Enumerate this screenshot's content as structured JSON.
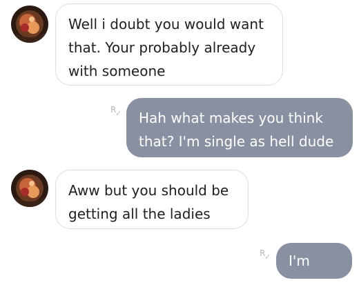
{
  "conversation": {
    "messages": [
      {
        "direction": "incoming",
        "text": "Well i doubt you would want\nthat. Your probably already\nwith someone"
      },
      {
        "direction": "outgoing",
        "text": "Hah what makes you think\nthat? I'm single as hell dude",
        "receipt_icon": "R"
      },
      {
        "direction": "incoming",
        "text": "Aww but you should be\ngetting all the ladies"
      },
      {
        "direction": "outgoing",
        "text": "I'm gay",
        "receipt_icon": "R"
      }
    ]
  },
  "colors": {
    "outgoing_bubble": "#8890a2",
    "incoming_bubble": "#ffffff",
    "incoming_border": "#dedede",
    "receipt": "#b4b8c2"
  },
  "icons": {
    "avatar": "contact-avatar-icon",
    "receipt": "read-receipt-icon"
  }
}
